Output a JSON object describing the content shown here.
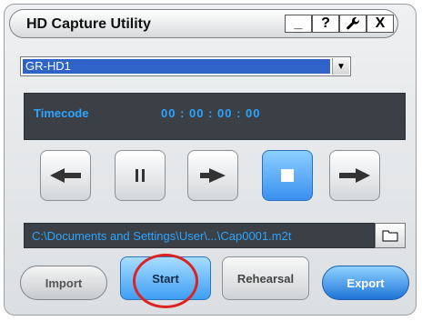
{
  "window": {
    "title": "HD Capture Utility"
  },
  "titlebar_buttons": {
    "minimize": "_",
    "help": "?",
    "close": "X"
  },
  "device": {
    "selected": "GR-HD1"
  },
  "timecode": {
    "label": "Timecode",
    "value": "00 : 00 : 00 : 00"
  },
  "path": {
    "text": "C:\\Documents and Settings\\User\\...\\Cap0001.m2t"
  },
  "buttons": {
    "import": "Import",
    "start": "Start",
    "rehearsal": "Rehearsal",
    "export": "Export"
  },
  "colors": {
    "accent": "#2da4ff",
    "panel": "#3a4045",
    "highlight": "#d22222"
  },
  "icons": {
    "rewind": "rewind-icon",
    "pause": "pause-icon",
    "play": "play-icon",
    "stop": "stop-icon",
    "fast_forward": "fast-forward-icon",
    "folder": "folder-icon",
    "wrench": "wrench-icon",
    "dropdown": "chevron-down-icon"
  }
}
